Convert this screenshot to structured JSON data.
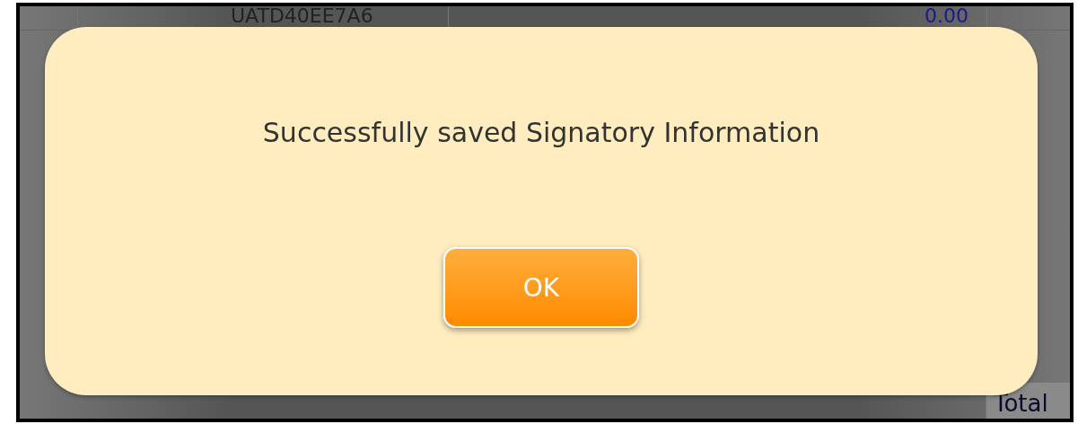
{
  "background_table": {
    "top_row": {
      "id": "UATD40EE7A6",
      "amount": "0.00"
    },
    "bottom_label": "Total"
  },
  "dialog": {
    "message": "Successfully saved Signatory Information",
    "buttons": [
      {
        "label": "OK"
      }
    ]
  }
}
